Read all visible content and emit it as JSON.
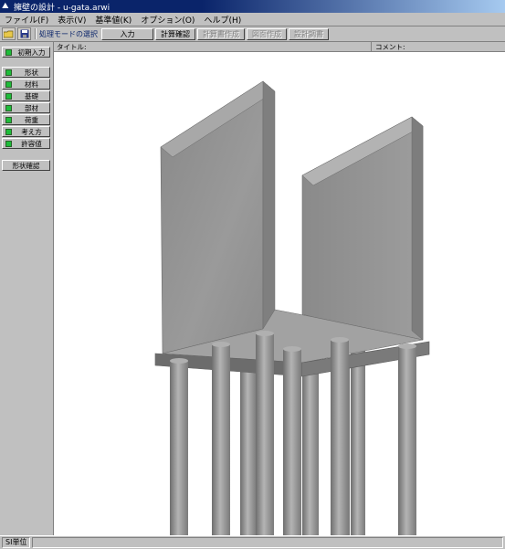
{
  "window": {
    "title": "擁壁の設計 - u-gata.arwi"
  },
  "menu": [
    "ファイル(F)",
    "表示(V)",
    "基準値(K)",
    "オプション(O)",
    "ヘルプ(H)"
  ],
  "toolbar": {
    "mode_label": "処理モードの選択",
    "buttons": [
      "入力",
      "計算確認",
      "計算書作成",
      "図面作成",
      "設計調書"
    ]
  },
  "sidebar": {
    "initial": "初期入力",
    "items": [
      "形状",
      "材料",
      "基礎",
      "部材",
      "荷重",
      "考え方",
      "許容値"
    ],
    "shape_check": "形状確認"
  },
  "header": {
    "title_label": "タイトル:",
    "comment_label": "コメント:"
  },
  "status": {
    "unit": "SI単位"
  },
  "colors": {
    "lamp": "#1dbd3a",
    "titlebar": "#0a246a",
    "panel": "#c0c0c0"
  }
}
